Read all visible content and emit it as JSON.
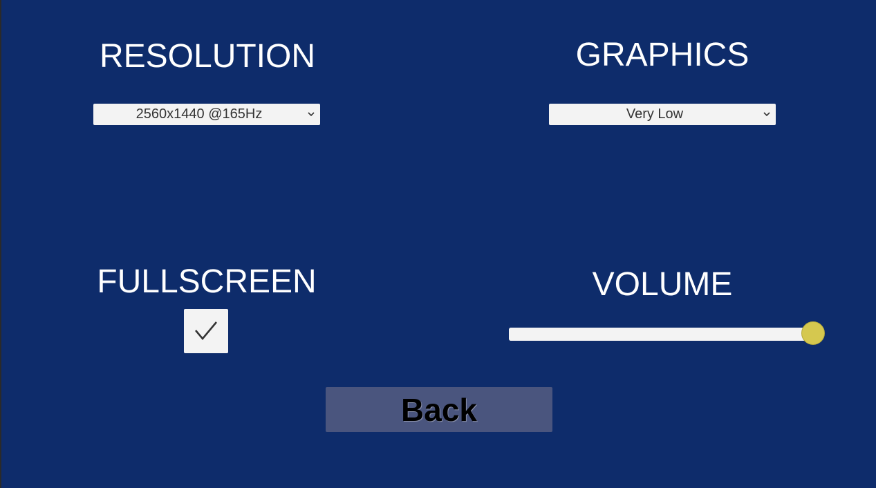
{
  "resolution": {
    "heading": "RESOLUTION",
    "selected": "2560x1440  @165Hz",
    "icon": "chevron-down-icon"
  },
  "graphics": {
    "heading": "GRAPHICS",
    "selected": "Very Low",
    "icon": "chevron-down-icon"
  },
  "fullscreen": {
    "heading": "FULLSCREEN",
    "checked": true,
    "icon": "checkmark-icon"
  },
  "volume": {
    "heading": "VOLUME",
    "value": 1.0,
    "handle_color": "#d5c84f"
  },
  "back_button": {
    "label": "Back"
  },
  "colors": {
    "background": "#0e2c6b",
    "control": "#f3f3f3",
    "button": "#4a557e"
  }
}
